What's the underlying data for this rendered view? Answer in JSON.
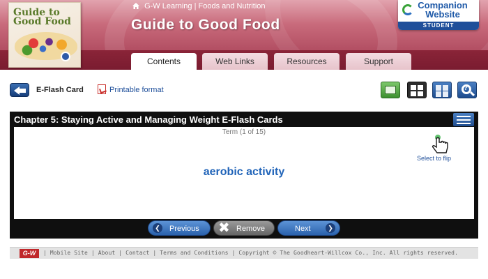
{
  "header": {
    "breadcrumb": "G-W Learning | Foods and Nutrition",
    "site_title": "Guide to Good Food",
    "book_title_line1": "Guide to",
    "book_title_line2": "Good Food",
    "companion_line1": "Companion",
    "companion_line2": "Website",
    "companion_audience": "STUDENT"
  },
  "tabs": [
    {
      "label": "Contents",
      "active": true
    },
    {
      "label": "Web Links",
      "active": false
    },
    {
      "label": "Resources",
      "active": false
    },
    {
      "label": "Support",
      "active": false
    }
  ],
  "toolbar": {
    "page_label": "E-Flash Card",
    "printable_link": "Printable format"
  },
  "flashcard": {
    "title": "Chapter 5: Staying Active and Managing Weight E-Flash Cards",
    "term_counter": "Term (1 of 15)",
    "term": "aerobic activity",
    "flip_hint": "Select to flip",
    "previous_label": "Previous",
    "remove_label": "Remove",
    "next_label": "Next"
  },
  "footer": {
    "logo": "G-W",
    "links": [
      "Mobile Site",
      "About",
      "Contact",
      "Terms and Conditions",
      "Copyright © The Goodheart-Willcox Co., Inc. All rights reserved."
    ]
  },
  "colors": {
    "header_rose": "#c86a7b",
    "header_band": "#7a1c30",
    "link_blue": "#1f4f9a",
    "term_blue": "#1f63b8",
    "card_frame": "#0f0f0f"
  }
}
